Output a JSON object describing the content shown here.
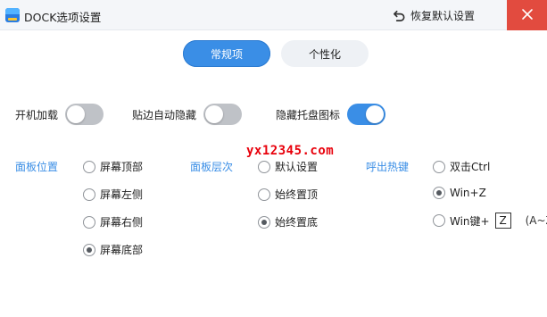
{
  "window": {
    "title": "DOCK选项设置",
    "restore_defaults_label": "恢复默认设置"
  },
  "tabs": [
    {
      "label": "常规项",
      "active": true
    },
    {
      "label": "个性化",
      "active": false
    }
  ],
  "toggles": [
    {
      "label": "开机加载",
      "on": false
    },
    {
      "label": "贴边自动隐藏",
      "on": false
    },
    {
      "label": "隐藏托盘图标",
      "on": true
    }
  ],
  "watermark": "yx12345.com",
  "panel_position": {
    "label": "面板位置",
    "options": [
      {
        "label": "屏幕顶部",
        "checked": false
      },
      {
        "label": "屏幕左侧",
        "checked": false
      },
      {
        "label": "屏幕右侧",
        "checked": false
      },
      {
        "label": "屏幕底部",
        "checked": true
      }
    ]
  },
  "panel_layer": {
    "label": "面板层次",
    "options": [
      {
        "label": "默认设置",
        "checked": false
      },
      {
        "label": "始终置顶",
        "checked": false
      },
      {
        "label": "始终置底",
        "checked": true
      }
    ]
  },
  "hotkey": {
    "label": "呼出热键",
    "options": [
      {
        "label": "双击Ctrl",
        "checked": false
      },
      {
        "label": "Win+Z",
        "checked": true
      },
      {
        "label": "Win键+",
        "checked": false
      }
    ],
    "custom_key": "Z",
    "custom_hint": "(A~Z)"
  },
  "colors": {
    "accent": "#3a8ee6",
    "close": "#e24b3f",
    "watermark": "#e8000b"
  }
}
